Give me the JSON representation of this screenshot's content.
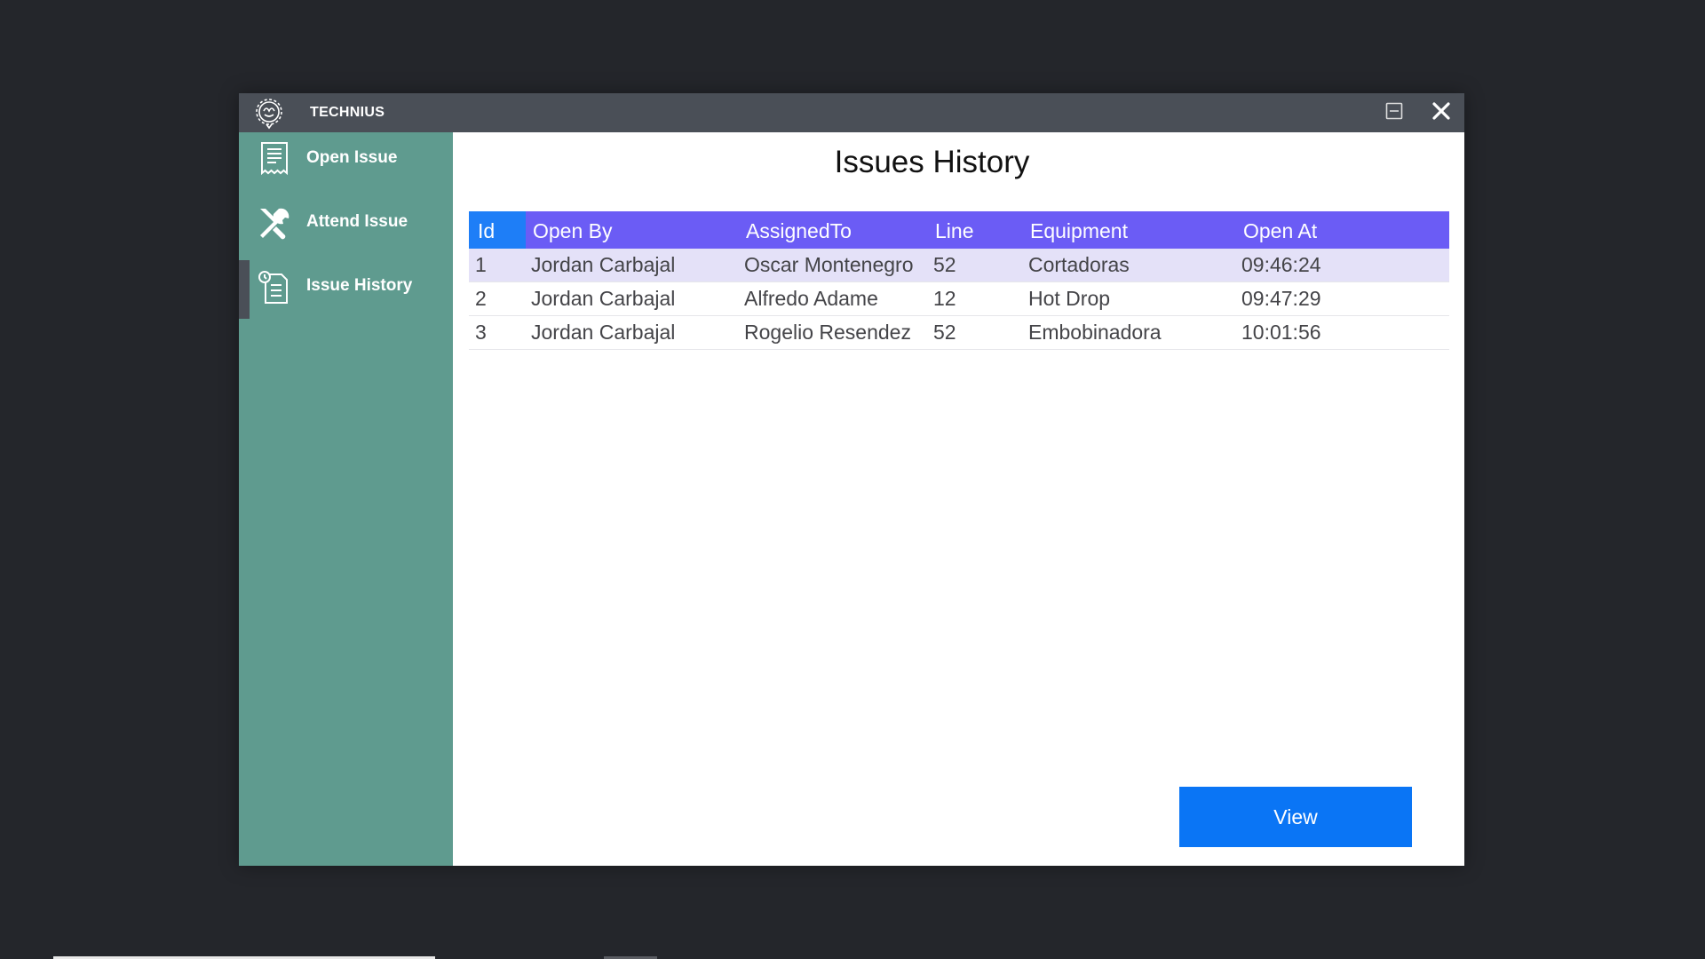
{
  "app": {
    "title": "TECHNIUS"
  },
  "sidebar": {
    "items": [
      {
        "label": "Open Issue",
        "icon": "document-icon"
      },
      {
        "label": "Attend Issue",
        "icon": "tools-icon"
      },
      {
        "label": "Issue History",
        "icon": "history-icon",
        "active": true
      }
    ]
  },
  "main": {
    "title": "Issues History",
    "table": {
      "columns": [
        "Id",
        "Open By",
        "AssignedTo",
        "Line",
        "Equipment",
        "Open At"
      ],
      "rows": [
        [
          "1",
          "Jordan Carbajal",
          "Oscar Montenegro",
          "52",
          "Cortadoras",
          "09:46:24"
        ],
        [
          "2",
          "Jordan Carbajal",
          "Alfredo Adame",
          "12",
          "Hot Drop",
          "09:47:29"
        ],
        [
          "3",
          "Jordan Carbajal",
          "Rogelio Resendez",
          "52",
          "Embobinadora",
          "10:01:56"
        ]
      ],
      "selected_row": 0
    },
    "view_button": "View"
  },
  "colors": {
    "titlebar": "#4a4f57",
    "sidebar": "#5f9b8f",
    "header": "#6b5cf5",
    "header_id": "#1e7ef7",
    "selected_row": "#e4e1f8",
    "button": "#0a75f5",
    "desktop": "#24262b"
  }
}
